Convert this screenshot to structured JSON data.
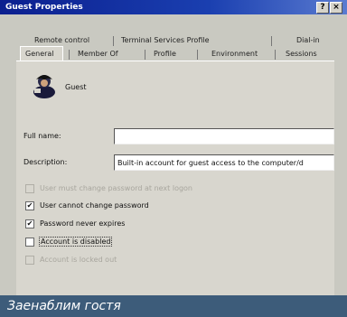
{
  "window": {
    "title": "Guest Properties",
    "help_label": "?",
    "close_label": "×"
  },
  "tabs_top": [
    "Remote control",
    "Terminal Services Profile",
    "Dial-in"
  ],
  "tabs_bottom": [
    "General",
    "Member Of",
    "Profile",
    "Environment",
    "Sessions"
  ],
  "user": {
    "name": "Guest",
    "icon": "user-icon"
  },
  "fields": {
    "full_name_label": "Full name:",
    "full_name_value": "",
    "description_label": "Description:",
    "description_value": "Built-in account for guest access to the computer/d"
  },
  "checkboxes": [
    {
      "label": "User must change password at next logon",
      "checked": false,
      "enabled": false
    },
    {
      "label": "User cannot change password",
      "checked": true,
      "enabled": true
    },
    {
      "label": "Password never expires",
      "checked": true,
      "enabled": true
    },
    {
      "label": "Account is disabled",
      "checked": false,
      "enabled": true
    },
    {
      "label": "Account is locked out",
      "checked": false,
      "enabled": false
    }
  ],
  "caption": "Заенаблим гостя"
}
